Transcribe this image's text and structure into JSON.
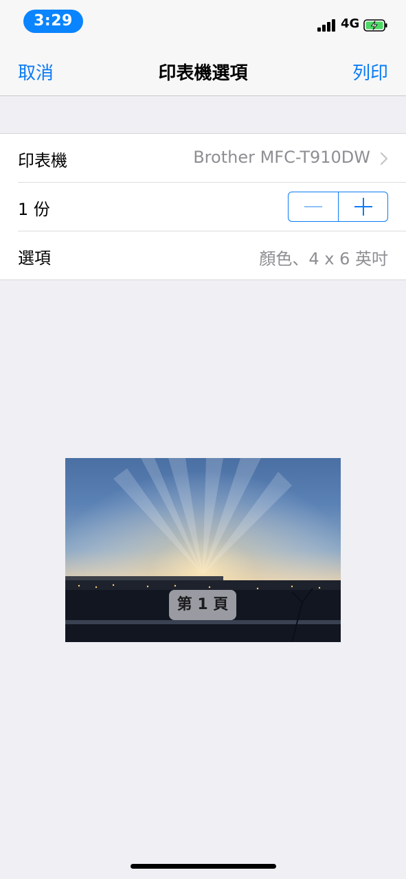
{
  "status_bar": {
    "time": "3:29",
    "network": "4G",
    "icons": [
      "signal-icon",
      "battery-charging-icon"
    ],
    "time_pill_color": "#0a84ff",
    "battery_color": "#4cd964"
  },
  "nav": {
    "cancel_label": "取消",
    "title": "印表機選項",
    "print_label": "列印",
    "accent_color": "#0a7bf5"
  },
  "settings": {
    "printer": {
      "label": "印表機",
      "value": "Brother MFC-T910DW"
    },
    "copies": {
      "label": "1 份",
      "count": 1
    },
    "options": {
      "label": "選項",
      "value": "顏色、4 x 6 英吋"
    }
  },
  "preview": {
    "page_label": "第 1 頁"
  }
}
